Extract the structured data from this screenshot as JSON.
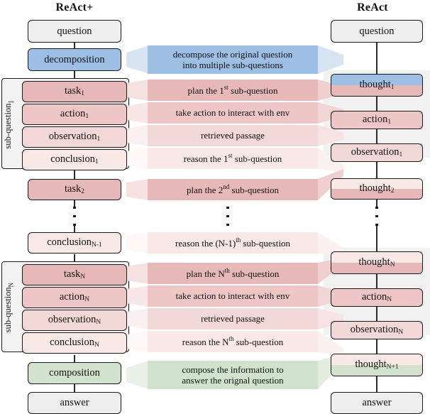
{
  "columns": {
    "left_title": "ReAct+",
    "right_title": "ReAct"
  },
  "colors": {
    "blue": "#9dbfe3",
    "green": "#d2e3cd",
    "gray": "#eeeeee",
    "pink_task": "#e6b8b8",
    "pink_action": "#eec6c6",
    "pink_observation": "#f3d8d8",
    "pink_conclusion": "#f8e9e7",
    "outline": "#1a1a1a"
  },
  "left_column": {
    "nodes": [
      {
        "id": "question",
        "label": "question",
        "sub": "",
        "fill": "gray"
      },
      {
        "id": "decomposition",
        "label": "decomposition",
        "sub": "",
        "fill": "blue"
      },
      {
        "id": "task-1",
        "label": "task",
        "sub": "1",
        "fill": "pink_task"
      },
      {
        "id": "action-1",
        "label": "action",
        "sub": "1",
        "fill": "pink_action"
      },
      {
        "id": "observation-1",
        "label": "observation",
        "sub": "1",
        "fill": "pink_observation"
      },
      {
        "id": "conclusion-1",
        "label": "conclusion",
        "sub": "1",
        "fill": "pink_conclusion"
      },
      {
        "id": "task-2",
        "label": "task",
        "sub": "2",
        "fill": "pink_task"
      },
      {
        "id": "conclusion-n-1",
        "label": "conclusion",
        "sub": "N-1",
        "fill": "pink_conclusion"
      },
      {
        "id": "task-n",
        "label": "task",
        "sub": "N",
        "fill": "pink_task"
      },
      {
        "id": "action-n",
        "label": "action",
        "sub": "N",
        "fill": "pink_action"
      },
      {
        "id": "observation-n",
        "label": "observation",
        "sub": "N",
        "fill": "pink_observation"
      },
      {
        "id": "conclusion-n",
        "label": "conclusion",
        "sub": "N",
        "fill": "pink_conclusion"
      },
      {
        "id": "composition",
        "label": "composition",
        "sub": "",
        "fill": "green"
      },
      {
        "id": "answer",
        "label": "answer",
        "sub": "",
        "fill": "gray"
      }
    ],
    "groups": [
      {
        "id": "sub-question-1",
        "label": "sub-question",
        "sub": "1"
      },
      {
        "id": "sub-question-n",
        "label": "sub-question",
        "sub": "N"
      }
    ]
  },
  "right_column": {
    "nodes": [
      {
        "id": "question",
        "label": "question",
        "sub": "",
        "fill": "gray"
      },
      {
        "id": "thought-1",
        "label": "thought",
        "sub": "1",
        "fill_top": "blue",
        "fill_bottom": "pink_task"
      },
      {
        "id": "action-1",
        "label": "action",
        "sub": "1",
        "fill": "pink_action"
      },
      {
        "id": "observation-1",
        "label": "observation",
        "sub": "1",
        "fill": "pink_observation"
      },
      {
        "id": "thought-2",
        "label": "thought",
        "sub": "2",
        "fill_top": "pink_conclusion",
        "fill_bottom": "pink_task"
      },
      {
        "id": "thought-n",
        "label": "thought",
        "sub": "N",
        "fill_top": "pink_conclusion",
        "fill_bottom": "pink_task"
      },
      {
        "id": "action-n",
        "label": "action",
        "sub": "N",
        "fill": "pink_action"
      },
      {
        "id": "observation-n",
        "label": "observation",
        "sub": "N",
        "fill": "pink_observation"
      },
      {
        "id": "thought-n-1",
        "label": "thought",
        "sub": "N+1",
        "fill_top": "pink_conclusion",
        "fill_bottom": "green"
      },
      {
        "id": "answer",
        "label": "answer",
        "sub": "",
        "fill": "gray"
      }
    ]
  },
  "annotations": [
    {
      "id": "decompose",
      "line1": "decompose the original question",
      "line2": "into multiple sub-questions",
      "fill": "blue"
    },
    {
      "id": "plan-1st",
      "pre": "plan the 1",
      "sup": "st",
      "post": " sub-question",
      "fill": "pink_task"
    },
    {
      "id": "take-action-1",
      "text": "take action to interact with env",
      "fill": "pink_action"
    },
    {
      "id": "retrieved-1",
      "text": "retrieved passage",
      "fill": "pink_observation"
    },
    {
      "id": "reason-1st",
      "pre": "reason the 1",
      "sup": "st",
      "post": " sub-question",
      "fill": "pink_conclusion"
    },
    {
      "id": "plan-2nd",
      "pre": "plan the 2",
      "sup": "nd",
      "post": " sub-question",
      "fill": "pink_task"
    },
    {
      "id": "reason-n-1th",
      "pre": "reason the (N-1)",
      "sup": "th",
      "post": " sub-question",
      "fill": "pink_conclusion"
    },
    {
      "id": "plan-nth",
      "pre": "plan the N",
      "sup": "th",
      "post": " sub-question",
      "fill": "pink_task"
    },
    {
      "id": "take-action-n",
      "text": "take action to interact with env",
      "fill": "pink_action"
    },
    {
      "id": "retrieved-n",
      "text": "retrieved passage",
      "fill": "pink_observation"
    },
    {
      "id": "reason-nth",
      "pre": "reason the N",
      "sup": "th",
      "post": " sub-question",
      "fill": "pink_conclusion"
    },
    {
      "id": "compose",
      "line1": "compose the information to",
      "line2": "answer the orignal question",
      "fill": "green"
    }
  ],
  "ellipsis": {
    "glyph": "vertical-ellipsis",
    "count": 3
  }
}
